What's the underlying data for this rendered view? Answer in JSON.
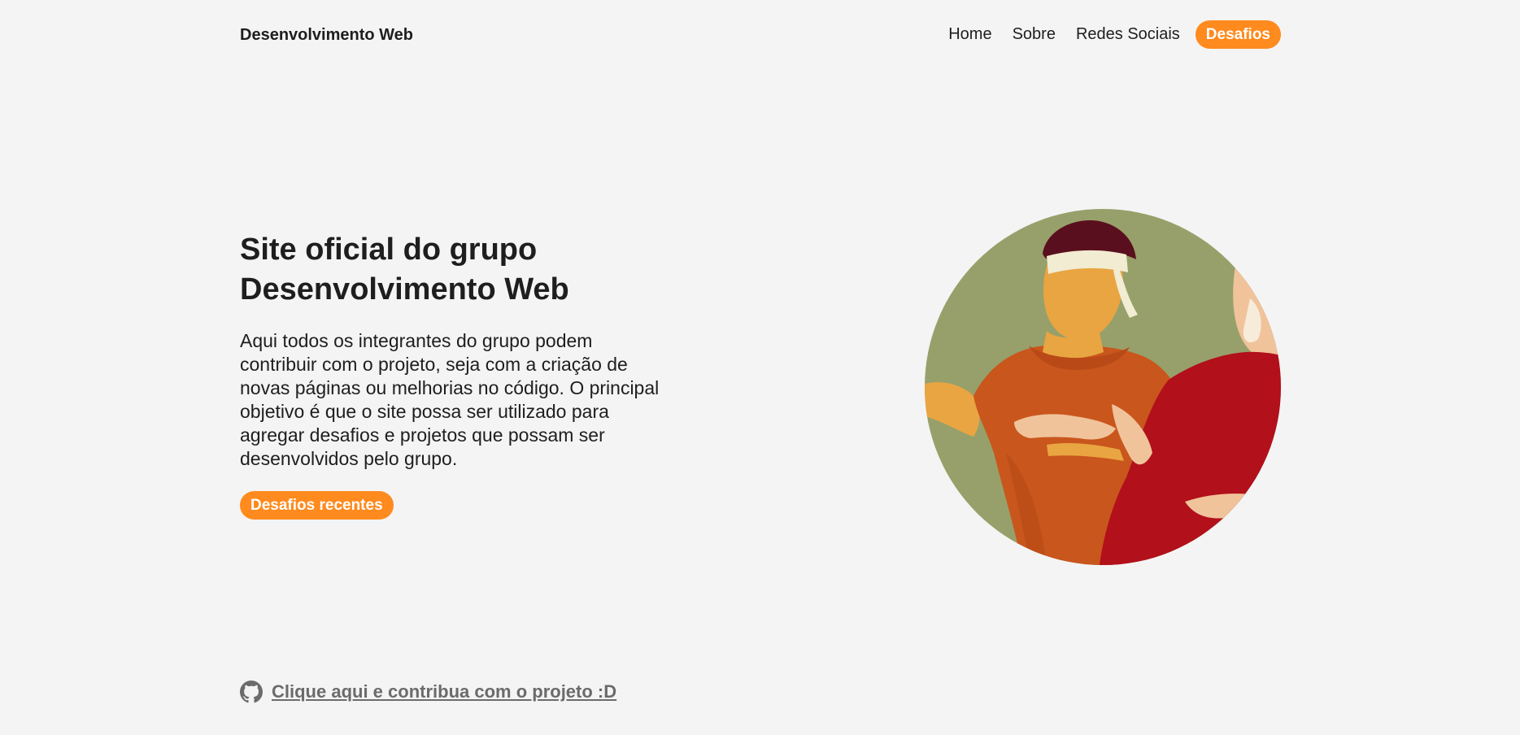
{
  "header": {
    "brand": "Desenvolvimento Web",
    "nav": [
      {
        "label": "Home"
      },
      {
        "label": "Sobre"
      },
      {
        "label": "Redes Sociais"
      }
    ],
    "cta_label": "Desafios"
  },
  "hero": {
    "title_lines": [
      "Site oficial do grupo",
      "Desenvolvimento Web"
    ],
    "description_lines": [
      "Aqui todos os integrantes do grupo podem",
      "contribuir com o projeto, seja com a criação de",
      "novas páginas ou melhorias no código. O principal",
      "objetivo é que o site possa ser utilizado para",
      "agregar desafios e projetos que possam ser",
      "desenvolvidos pelo grupo."
    ],
    "button_label": "Desafios recentes",
    "illustration": "group-illustration"
  },
  "footer": {
    "icon": "github-icon",
    "link_text": "Clique aqui e contribua com o projeto :D"
  },
  "colors": {
    "accent": "#ff8a1d",
    "background": "#f4f4f4",
    "text": "#1e1e1e",
    "link": "#6b6b6b"
  }
}
